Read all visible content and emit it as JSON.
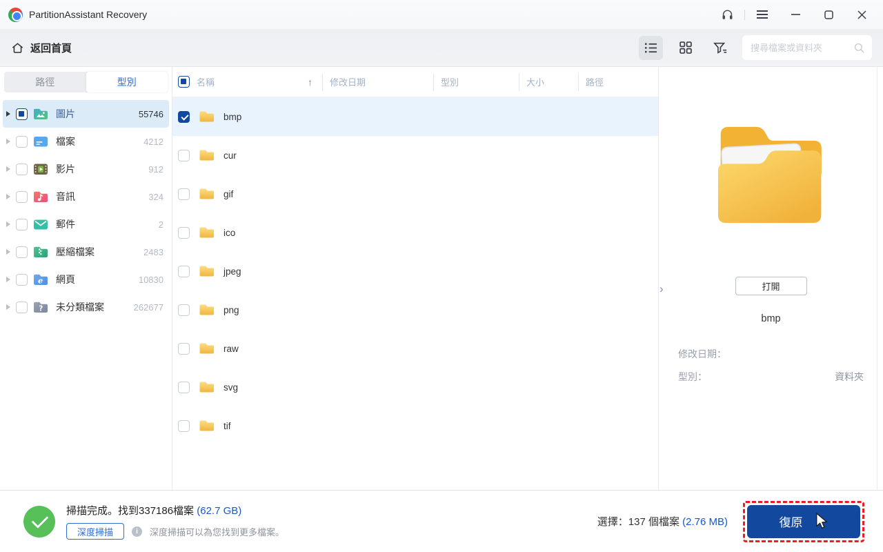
{
  "colors": {
    "accent": "#2e6bd6",
    "link": "#1458cc",
    "primary_button": "#12489e",
    "highlight_dashed": "#ec1c24",
    "success": "#57c059",
    "folder_yellow": "#f5bf42",
    "sidebar_selected": "#dcebf8",
    "row_selected": "#e9f3fd"
  },
  "titlebar": {
    "title": "PartitionAssistant Recovery"
  },
  "toolbar": {
    "back_home": "返回首頁",
    "active_view": "list",
    "search": {
      "value": "",
      "placeholder": "搜尋檔案或資料夾"
    }
  },
  "sidebar": {
    "tabs": [
      {
        "label": "路徑",
        "active": false
      },
      {
        "label": "型別",
        "active": true
      }
    ],
    "items": [
      {
        "label": "圖片",
        "count": "55746",
        "icon": "images-folder",
        "checked": "indeterminate",
        "selected": true
      },
      {
        "label": "檔案",
        "count": "4212",
        "icon": "documents-folder",
        "checked": false,
        "selected": false
      },
      {
        "label": "影片",
        "count": "912",
        "icon": "videos-folder",
        "checked": false,
        "selected": false
      },
      {
        "label": "音訊",
        "count": "324",
        "icon": "audio-folder",
        "checked": false,
        "selected": false
      },
      {
        "label": "郵件",
        "count": "2",
        "icon": "mail-folder",
        "checked": false,
        "selected": false
      },
      {
        "label": "壓縮檔案",
        "count": "2483",
        "icon": "archive-folder",
        "checked": false,
        "selected": false
      },
      {
        "label": "網頁",
        "count": "10830",
        "icon": "web-folder",
        "checked": false,
        "selected": false
      },
      {
        "label": "未分類檔案",
        "count": "262677",
        "icon": "unknown-folder",
        "checked": false,
        "selected": false
      }
    ]
  },
  "table": {
    "columns": [
      "名稱",
      "修改日期",
      "型別",
      "大小",
      "路徑"
    ],
    "sort": {
      "column": "名稱",
      "ascending": true
    },
    "rows": [
      {
        "name": "bmp",
        "type": "folder",
        "checked": true,
        "selected": true
      },
      {
        "name": "cur",
        "type": "folder",
        "checked": false,
        "selected": false
      },
      {
        "name": "gif",
        "type": "folder",
        "checked": false,
        "selected": false
      },
      {
        "name": "ico",
        "type": "folder",
        "checked": false,
        "selected": false
      },
      {
        "name": "jpeg",
        "type": "folder",
        "checked": false,
        "selected": false
      },
      {
        "name": "png",
        "type": "folder",
        "checked": false,
        "selected": false
      },
      {
        "name": "raw",
        "type": "folder",
        "checked": false,
        "selected": false
      },
      {
        "name": "svg",
        "type": "folder",
        "checked": false,
        "selected": false
      },
      {
        "name": "tif",
        "type": "folder",
        "checked": false,
        "selected": false
      }
    ]
  },
  "preview": {
    "open_button": "打開",
    "file_name": "bmp",
    "modified_label": "修改日期：",
    "modified_value": "",
    "type_label": "型別：",
    "type_value": "資料夾"
  },
  "statusbar": {
    "scan_text": "掃描完成。找到337186檔案",
    "scan_size": "(62.7 GB)",
    "deep_scan_button": "深度掃描",
    "deep_scan_hint": "深度掃描可以為您找到更多檔案。",
    "selection_text": "選擇：137 個檔案",
    "selection_size": "(2.76 MB)",
    "recover_button": "復原"
  }
}
